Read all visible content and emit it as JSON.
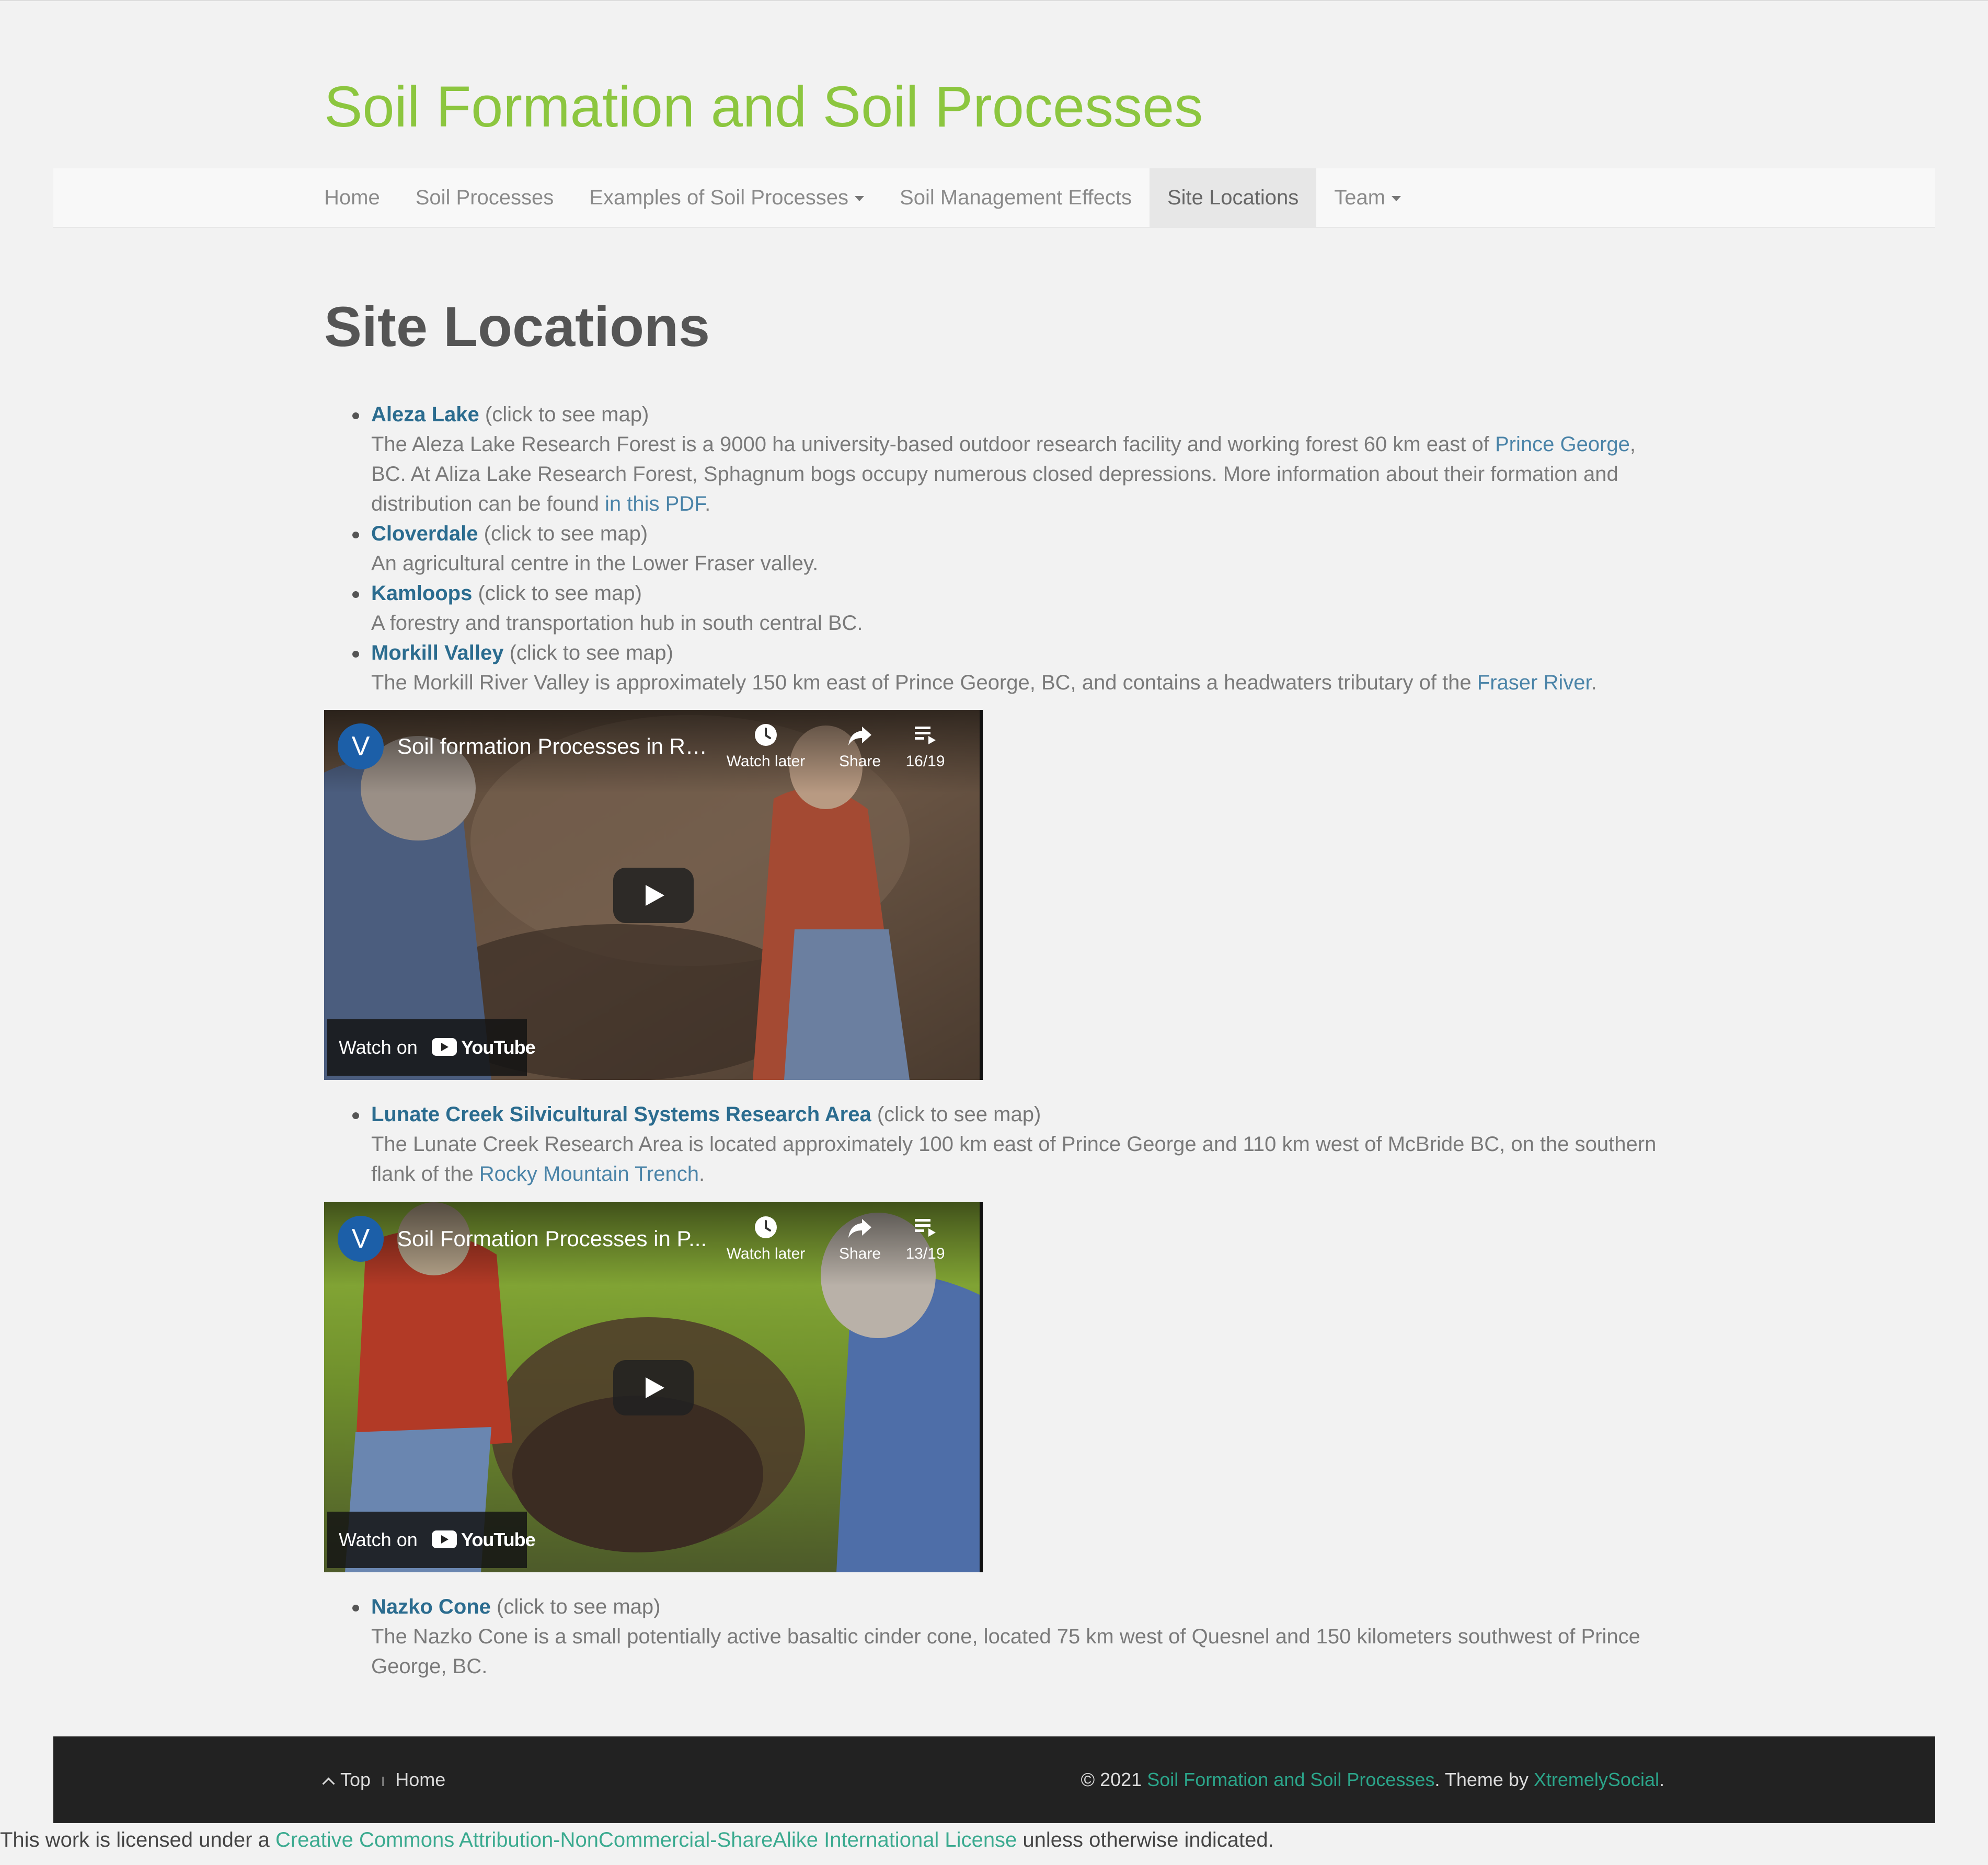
{
  "site_title": "Soil Formation and Soil Processes",
  "nav": {
    "items": [
      {
        "label": "Home"
      },
      {
        "label": "Soil Processes"
      },
      {
        "label": "Examples of Soil Processes"
      },
      {
        "label": "Soil Management Effects"
      },
      {
        "label": "Site Locations"
      },
      {
        "label": "Team"
      }
    ]
  },
  "page_title": "Site Locations",
  "sites": [
    {
      "name": "Aleza Lake",
      "hint": " (click to see map)",
      "desc_a": "The Aleza Lake Research Forest is a 9000 ha university-based outdoor research facility and working forest 60 km east of ",
      "link_a": "Prince George",
      "desc_b": ", BC. At Aliza Lake Research Forest, Sphagnum bogs occupy numerous closed depressions. More information about their formation and distribution can be found ",
      "link_b": "in this PDF",
      "desc_c": "."
    },
    {
      "name": "Cloverdale",
      "hint": " (click to see map)",
      "desc": "An agricultural centre in the Lower Fraser valley."
    },
    {
      "name": "Kamloops",
      "hint": " (click to see map)",
      "desc": "A forestry and transportation hub in south central BC."
    },
    {
      "name": "Morkill Valley",
      "hint": " (click to see map)",
      "desc_a": "The Morkill River Valley is approximately 150 km east of Prince George, BC, and contains a headwaters tributary of the ",
      "link_a": "Fraser River",
      "desc_b": "."
    },
    {
      "name": "Lunate Creek Silvicultural Systems Research Area",
      "hint": " (click to see map)",
      "desc_a": "The Lunate Creek Research Area is located approximately 100 km east of Prince George and 110 km west of McBride BC, on the southern flank of the ",
      "link_a": "Rocky Mountain Trench",
      "desc_b": "."
    },
    {
      "name": "Nazko Cone",
      "hint": " (click to see map)",
      "desc": "The Nazko Cone is a small potentially active basaltic cinder cone, located 75 km west of Quesnel and 150 kilometers southwest of Prince George, BC."
    }
  ],
  "videos": [
    {
      "avatar": "V",
      "title": "Soil formation Processes in Re...",
      "watch_later": "Watch later",
      "share": "Share",
      "playlist": "16/19",
      "watch_on": "Watch on",
      "brand": "YouTube"
    },
    {
      "avatar": "V",
      "title": "Soil Formation Processes in P...",
      "watch_later": "Watch later",
      "share": "Share",
      "playlist": "13/19",
      "watch_on": "Watch on",
      "brand": "YouTube"
    }
  ],
  "footer": {
    "top": "Top",
    "sep": "I",
    "home": "Home",
    "copyright": "© 2021 ",
    "site_link": "Soil Formation and Soil Processes",
    "theme_by": ". Theme by ",
    "theme_link": "XtremelySocial",
    "end": "."
  },
  "license": {
    "pre": "This work is licensed under a ",
    "link": "Creative Commons Attribution-NonCommercial-ShareAlike International License",
    "post": " unless otherwise indicated."
  },
  "colors": {
    "site_title": "#8cc63f",
    "link": "#2b6c8f",
    "footer_link": "#2ba58a",
    "footer_bg": "#222222"
  },
  "icons": [
    "clock-icon",
    "share-arrow-icon",
    "playlist-icon",
    "play-icon",
    "youtube-logo-icon",
    "chevron-up-icon"
  ]
}
